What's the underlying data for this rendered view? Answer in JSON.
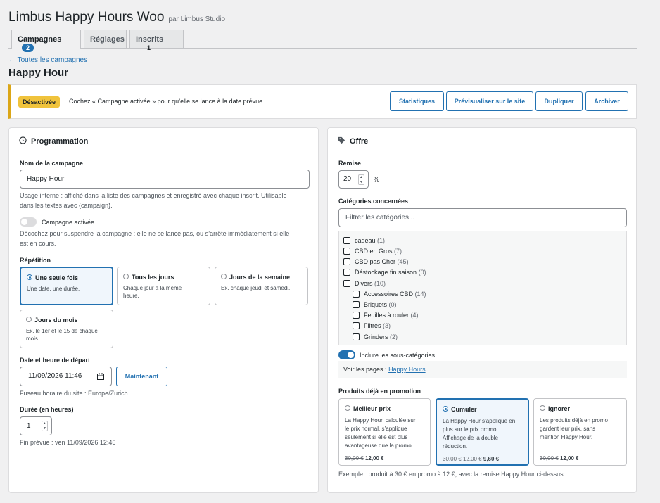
{
  "header": {
    "title": "Limbus Happy Hours Woo",
    "by": "par Limbus Studio"
  },
  "tabs": [
    {
      "label": "Campagnes",
      "count": "2"
    },
    {
      "label": "Réglages"
    },
    {
      "label": "Inscrits",
      "count": "1"
    }
  ],
  "back_link": "← Toutes les campagnes",
  "page_title": "Happy Hour",
  "notice": {
    "badge": "Désactivée",
    "text": "Cochez « Campagne activée » pour qu’elle se lance à la date prévue.",
    "buttons": [
      "Statistiques",
      "Prévisualiser sur le site",
      "Dupliquer",
      "Archiver"
    ]
  },
  "programmation": {
    "title": "Programmation",
    "name_label": "Nom de la campagne",
    "name_value": "Happy Hour",
    "name_help_1": "Usage interne : affiché dans la liste des campagnes et enregistré avec chaque inscrit. Utilisable",
    "name_help_2": "dans les textes avec {campaign}.",
    "active_label": "Campagne activée",
    "active_help_1": "Décochez pour suspendre la campagne : elle ne se lance pas, ou s’arrête immédiatement si elle",
    "active_help_2": "est en cours.",
    "repeat_label": "Répétition",
    "repeat_options": [
      {
        "title": "Une seule fois",
        "desc1": "Une date, une durée.",
        "desc2": ""
      },
      {
        "title": "Tous les jours",
        "desc1": "Chaque jour à la même",
        "desc2": "heure."
      },
      {
        "title": "Jours de la semaine",
        "desc1": "Ex. chaque jeudi et samedi.",
        "desc2": ""
      },
      {
        "title": "Jours du mois",
        "desc1": "Ex. le 1er et le 15 de chaque",
        "desc2": "mois."
      }
    ],
    "start_label": "Date et heure de départ",
    "start_value": "11/09/2026  11:46",
    "now_button": "Maintenant",
    "timezone": "Fuseau horaire du site : Europe/Zurich",
    "duration_label": "Durée (en heures)",
    "duration_value": "1",
    "end_text": "Fin prévue : ven 11/09/2026 12:46"
  },
  "offre": {
    "title": "Offre",
    "discount_label": "Remise",
    "discount_value": "20",
    "discount_unit": "%",
    "cats_label": "Catégories concernées",
    "cats_placeholder": "Filtrer les catégories...",
    "categories": [
      {
        "name": "cadeau",
        "count": "(1)"
      },
      {
        "name": "CBD en Gros",
        "count": "(7)"
      },
      {
        "name": "CBD pas Cher",
        "count": "(45)"
      },
      {
        "name": "Déstockage fin saison",
        "count": "(0)"
      },
      {
        "name": "Divers",
        "count": "(10)"
      },
      {
        "name": "Accessoires CBD",
        "count": "(14)"
      },
      {
        "name": "Briquets",
        "count": "(0)"
      },
      {
        "name": "Feuilles à rouler",
        "count": "(4)"
      },
      {
        "name": "Filtres",
        "count": "(3)"
      },
      {
        "name": "Grinders",
        "count": "(2)"
      }
    ],
    "subcats_label": "Inclure les sous-catégories",
    "pages_prefix": "Voir les pages :",
    "pages_link": "Happy Hours",
    "promo_label": "Produits déjà en promotion",
    "promo_options": [
      {
        "title": "Meilleur prix",
        "d1": "La Happy Hour, calculée sur",
        "d2": "le prix normal, s’applique",
        "d3": "seulement si elle est plus",
        "d4": "avantageuse que la promo.",
        "old": "30,00 €",
        "old2": "",
        "new": "12,00 €"
      },
      {
        "title": "Cumuler",
        "d1": "La Happy Hour s’applique en",
        "d2": "plus sur le prix promo.",
        "d3": "Affichage de la double",
        "d4": "réduction.",
        "old": "30,00 €",
        "old2": "12,00 €",
        "new": "9,60 €"
      },
      {
        "title": "Ignorer",
        "d1": "Les produits déjà en promo",
        "d2": "gardent leur prix, sans",
        "d3": "mention Happy Hour.",
        "d4": "",
        "old": "30,00 €",
        "old2": "",
        "new": "12,00 €"
      }
    ],
    "example": "Exemple : produit à 30 € en promo à 12 €, avec la remise Happy Hour ci-dessus."
  },
  "colors": {
    "accent": "#2271b1",
    "warning": "#dba617",
    "badge": "#f0c33c"
  }
}
